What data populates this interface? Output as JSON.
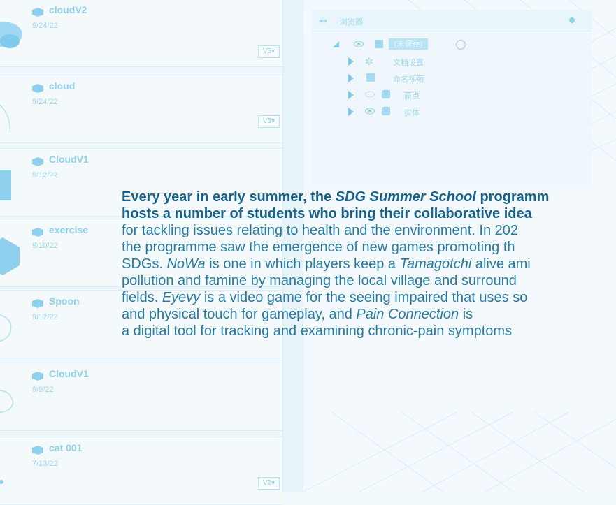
{
  "files": [
    {
      "name": "cloudV2",
      "date": "9/24/22",
      "version": "V6"
    },
    {
      "name": "cloud",
      "date": "9/24/22",
      "version": "V5"
    },
    {
      "name": "CloudV1",
      "date": "9/12/22",
      "version": ""
    },
    {
      "name": "exercise",
      "date": "9/10/22",
      "version": ""
    },
    {
      "name": "Spoon",
      "date": "9/12/22",
      "version": ""
    },
    {
      "name": "CloudV1",
      "date": "9/9/22",
      "version": ""
    },
    {
      "name": "cat 001",
      "date": "7/13/22",
      "version": "V2"
    }
  ],
  "browser": {
    "title": "浏览器",
    "root": "(未保存)",
    "items": [
      "文档设置",
      "命名视图",
      "原点",
      "实体"
    ]
  },
  "article": {
    "l1a": "Every year in early summer, the ",
    "l1b": "SDG Summer School",
    "l1c": " programm",
    "l2": "hosts a number of students who bring their collaborative idea",
    "l3": "for tackling issues relating to health and the environment. In 202",
    "l4": "the programme saw the emergence of new games promoting th",
    "l5a": "SDGs. ",
    "l5b": "NoWa",
    "l5c": " is one in which players keep a ",
    "l5d": "Tamagotchi",
    "l5e": " alive ami",
    "l6": "pollution and famine by managing the local village and surround",
    "l7a": "fields. ",
    "l7b": "Eyevy",
    "l7c": " is a video game for the seeing impaired that uses so",
    "l8a": "and physical touch for gameplay, and ",
    "l8b": "Pain Connection",
    "l8c": " is",
    "l9": "a digital tool for tracking and examining chronic-pain symptoms"
  },
  "colors": {
    "accent": "#8fd0ef",
    "text": "#1a6b92"
  }
}
